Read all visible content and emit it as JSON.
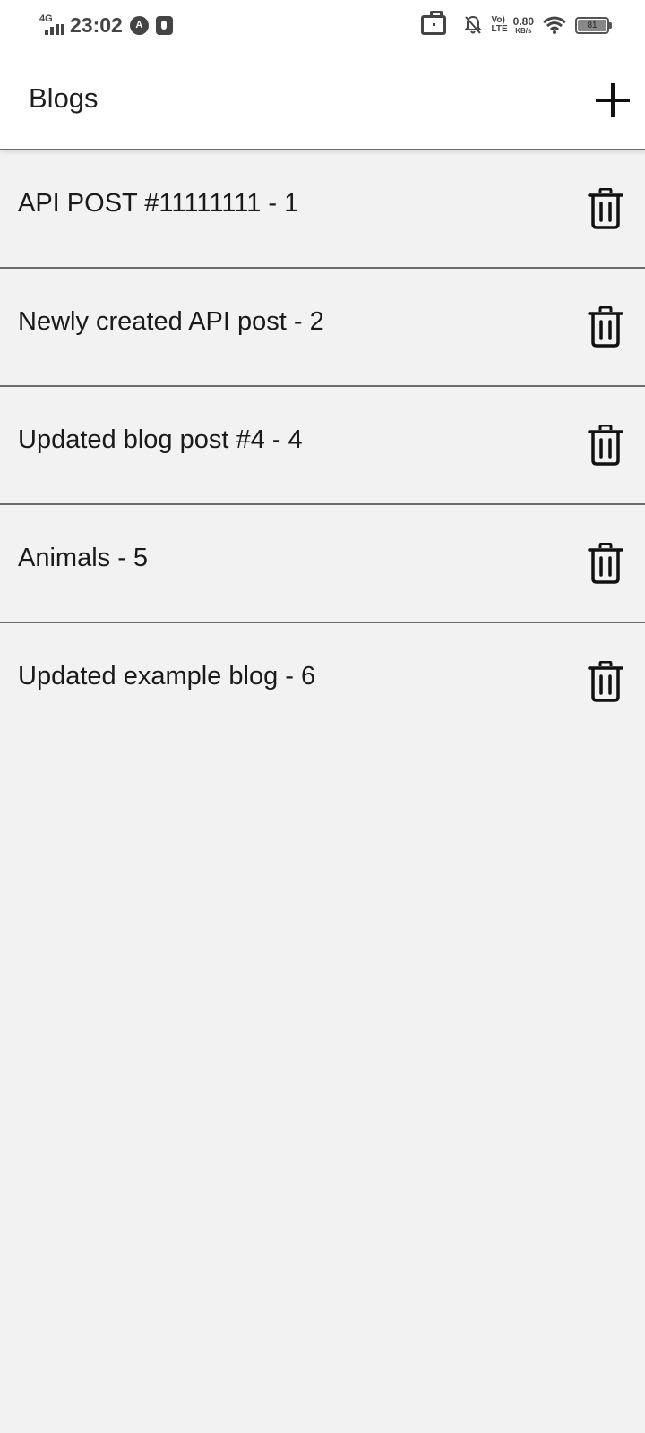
{
  "status_bar": {
    "network": "4G",
    "time": "23:02",
    "app_badge": "A",
    "volte_top": "Vo)",
    "volte_bottom": "LTE",
    "speed_value": "0.80",
    "speed_unit": "KB/s",
    "battery": "81",
    "icons": [
      "signal-icon",
      "notification-a-icon",
      "mic-icon",
      "briefcase-icon",
      "bell-off-icon",
      "volte-icon",
      "wifi-icon",
      "battery-icon"
    ]
  },
  "app_bar": {
    "title": "Blogs",
    "add_icon": "plus-icon"
  },
  "blogs": [
    {
      "title": "API POST #11111111 - 1",
      "action_icon": "trash-icon"
    },
    {
      "title": "Newly created API post - 2",
      "action_icon": "trash-icon"
    },
    {
      "title": "Updated blog post #4 - 4",
      "action_icon": "trash-icon"
    },
    {
      "title": "Animals - 5",
      "action_icon": "trash-icon"
    },
    {
      "title": "Updated example blog - 6",
      "action_icon": "trash-icon"
    }
  ],
  "colors": {
    "background": "#f2f2f2",
    "app_bar": "#ffffff",
    "divider": "#6d6d6d",
    "text": "#1a1a1a"
  }
}
